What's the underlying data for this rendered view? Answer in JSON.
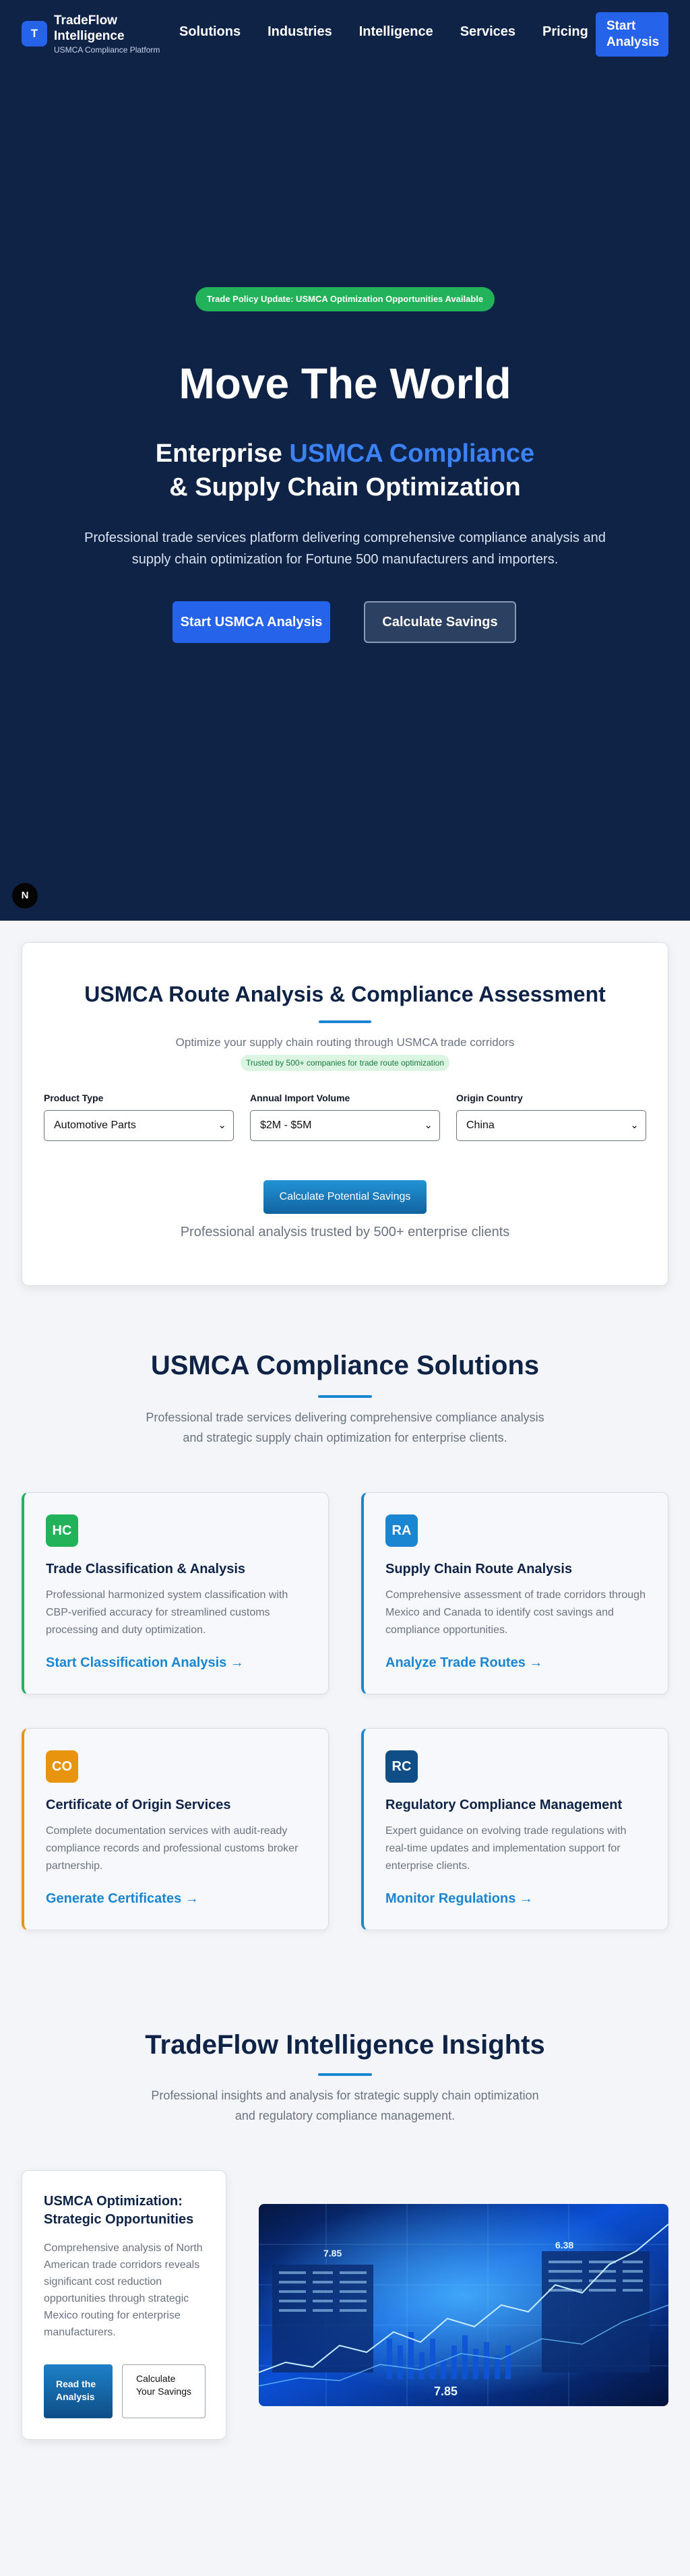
{
  "nav": {
    "logo_letter": "T",
    "brand": "TradeFlow Intelligence",
    "tagline": "USMCA Compliance Platform",
    "links": [
      "Solutions",
      "Industries",
      "Intelligence",
      "Services",
      "Pricing"
    ],
    "cta": "Start Analysis"
  },
  "hero": {
    "badge": "Trade Policy Update: USMCA Optimization Opportunities Available",
    "title": "Move The World",
    "subtitle_prefix": "Enterprise ",
    "subtitle_accent": "USMCA Compliance",
    "subtitle_line2": "& Supply Chain Optimization",
    "description": "Professional trade services platform delivering comprehensive compliance analysis and supply chain optimization for Fortune 500 manufacturers and importers.",
    "primary_button": "Start USMCA Analysis",
    "secondary_button": "Calculate Savings",
    "corner_badge": "N"
  },
  "route_analysis": {
    "title": "USMCA Route Analysis & Compliance Assessment",
    "subtitle": "Optimize your supply chain routing through USMCA trade corridors",
    "trusted_pill": "Trusted by 500+ companies for trade route optimization",
    "fields": [
      {
        "label": "Product Type",
        "value": "Automotive Parts"
      },
      {
        "label": "Annual Import Volume",
        "value": "$2M - $5M"
      },
      {
        "label": "Origin Country",
        "value": "China"
      }
    ],
    "button": "Calculate Potential Savings",
    "footer": "Professional analysis trusted by 500+ enterprise clients"
  },
  "solutions": {
    "title": "USMCA Compliance Solutions",
    "description": "Professional trade services delivering comprehensive compliance analysis and strategic supply chain optimization for enterprise clients.",
    "cards": [
      {
        "icon": "HC",
        "icon_color": "#22b35a",
        "title": "Trade Classification & Analysis",
        "description": "Professional harmonized system classification with CBP-verified accuracy for streamlined customs processing and duty optimization.",
        "link": "Start Classification Analysis →"
      },
      {
        "icon": "RA",
        "icon_color": "#1a86d1",
        "title": "Supply Chain Route Analysis",
        "description": "Comprehensive assessment of trade corridors through Mexico and Canada to identify cost savings and compliance opportunities.",
        "link": "Analyze Trade Routes →"
      },
      {
        "icon": "CO",
        "icon_color": "#e8940f",
        "title": "Certificate of Origin Services",
        "description": "Complete documentation services with audit-ready compliance records and professional customs broker partnership.",
        "link": "Generate Certificates →"
      },
      {
        "icon": "RC",
        "icon_color": "#0f4e86",
        "title": "Regulatory Compliance Management",
        "description": "Expert guidance on evolving trade regulations with real-time updates and implementation support for enterprise clients.",
        "link": "Monitor Regulations →"
      }
    ]
  },
  "insights": {
    "title": "TradeFlow Intelligence Insights",
    "description": "Professional insights and analysis for strategic supply chain optimization and regulatory compliance management.",
    "card": {
      "title": "USMCA Optimization: Strategic Opportunities",
      "description": "Comprehensive analysis of North American trade corridors reveals significant cost reduction opportunities through strategic Mexico routing for enterprise manufacturers.",
      "read_button": "Read the Analysis",
      "calc_button": "Calculate Your Savings"
    },
    "image_numbers": [
      "7.85",
      "6.38",
      "7.85"
    ]
  },
  "colors": {
    "navy": "#0f2347",
    "accent_blue": "#2563eb",
    "sky": "#1a86d1",
    "green": "#22b35a",
    "orange": "#e8940f"
  }
}
